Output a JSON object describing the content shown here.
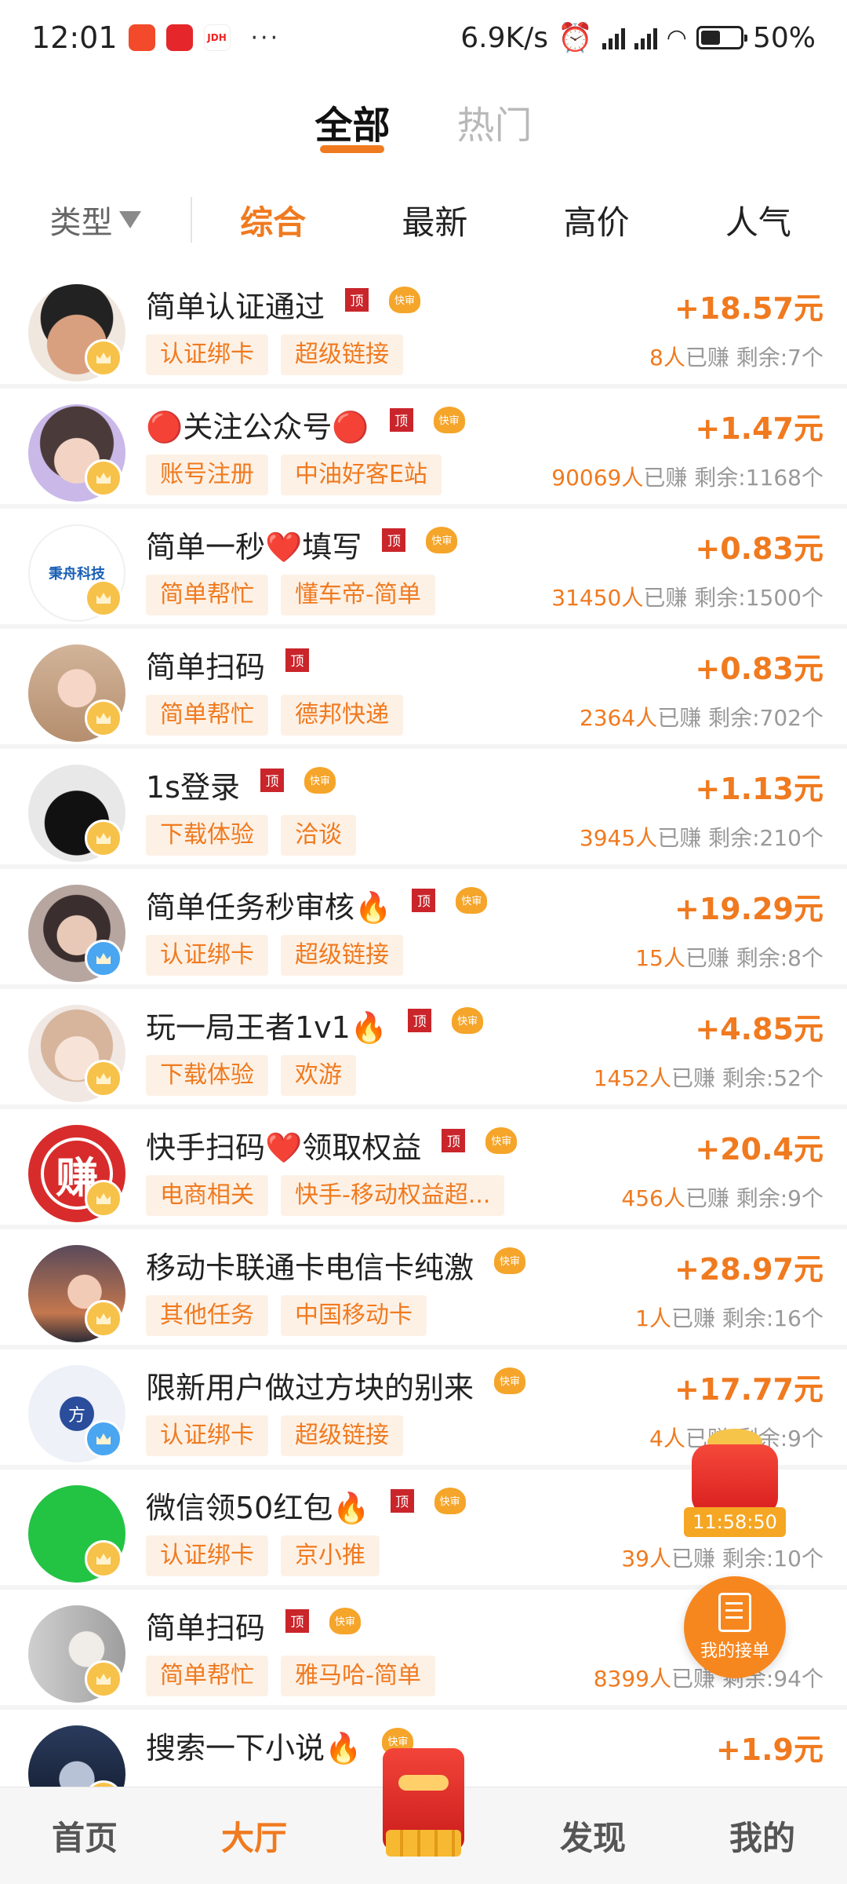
{
  "status_bar": {
    "time": "12:01",
    "app_icons": [
      "taobao-icon",
      "pdd-icon",
      "jdh-icon"
    ],
    "jdh_label": "JDH",
    "more": "···",
    "net_speed": "6.9K/s",
    "battery": "50%",
    "battery_level": 0.5
  },
  "top_tabs": [
    {
      "label": "全部",
      "active": true
    },
    {
      "label": "热门",
      "active": false
    }
  ],
  "filters": {
    "type_label": "类型",
    "sorts": [
      {
        "label": "综合",
        "active": true
      },
      {
        "label": "最新",
        "active": false
      },
      {
        "label": "高价",
        "active": false
      },
      {
        "label": "人气",
        "active": false
      }
    ]
  },
  "badges": {
    "ding": "顶",
    "kuai": "快审"
  },
  "tasks": [
    {
      "title": "简单认证通过",
      "ding": true,
      "kuai": true,
      "tags": [
        "认证绑卡",
        "超级链接"
      ],
      "price": "+18.57元",
      "earned": "8人",
      "earned_suffix": "已赚",
      "remaining": "剩余:7个",
      "avatar": "av-face1",
      "avatar_text": ""
    },
    {
      "title": "🔴关注公众号🔴",
      "ding": true,
      "kuai": true,
      "tags": [
        "账号注册",
        "中油好客E站"
      ],
      "price": "+1.47元",
      "earned": "90069人",
      "earned_suffix": "已赚",
      "remaining": "剩余:1168个",
      "avatar": "av-girl",
      "avatar_text": ""
    },
    {
      "title": "简单一秒❤️填写",
      "ding": true,
      "kuai": true,
      "tags": [
        "简单帮忙",
        "懂车帝-简单"
      ],
      "price": "+0.83元",
      "earned": "31450人",
      "earned_suffix": "已赚",
      "remaining": "剩余:1500个",
      "avatar": "av-logo",
      "avatar_text": "秉舟科技"
    },
    {
      "title": "简单扫码",
      "ding": true,
      "kuai": false,
      "tags": [
        "简单帮忙",
        "德邦快递"
      ],
      "price": "+0.83元",
      "earned": "2364人",
      "earned_suffix": "已赚",
      "remaining": "剩余:702个",
      "avatar": "av-room",
      "avatar_text": ""
    },
    {
      "title": "1s登录",
      "ding": true,
      "kuai": true,
      "tags": [
        "下载体验",
        "洽谈"
      ],
      "price": "+1.13元",
      "earned": "3945人",
      "earned_suffix": "已赚",
      "remaining": "剩余:210个",
      "avatar": "av-bat",
      "avatar_text": ""
    },
    {
      "title": "简单任务秒审核🔥",
      "ding": true,
      "kuai": true,
      "tags": [
        "认证绑卡",
        "超级链接"
      ],
      "price": "+19.29元",
      "earned": "15人",
      "earned_suffix": "已赚",
      "remaining": "剩余:8个",
      "avatar": "av-glasses",
      "avatar_text": "",
      "badge_blue": true
    },
    {
      "title": "玩一局王者1v1🔥",
      "ding": true,
      "kuai": true,
      "tags": [
        "下载体验",
        "欢游"
      ],
      "price": "+4.85元",
      "earned": "1452人",
      "earned_suffix": "已赚",
      "remaining": "剩余:52个",
      "avatar": "av-doll",
      "avatar_text": ""
    },
    {
      "title": "快手扫码❤️领取权益",
      "ding": true,
      "kuai": true,
      "tags": [
        "电商相关",
        "快手-移动权益超..."
      ],
      "price": "+20.4元",
      "earned": "456人",
      "earned_suffix": "已赚",
      "remaining": "剩余:9个",
      "avatar": "av-zhuan",
      "avatar_text": "赚"
    },
    {
      "title": "移动卡联通卡电信卡纯激",
      "ding": false,
      "kuai": true,
      "tags": [
        "其他任务",
        "中国移动卡"
      ],
      "price": "+28.97元",
      "earned": "1人",
      "earned_suffix": "已赚",
      "remaining": "剩余:16个",
      "avatar": "av-sunset",
      "avatar_text": ""
    },
    {
      "title": "限新用户做过方块的别来",
      "ding": false,
      "kuai": true,
      "tags": [
        "认证绑卡",
        "超级链接"
      ],
      "price": "+17.77元",
      "earned": "4人",
      "earned_suffix": "已赚",
      "remaining": "剩余:9个",
      "avatar": "av-block",
      "avatar_text": "方",
      "badge_blue": true
    },
    {
      "title": "微信领50红包🔥",
      "ding": true,
      "kuai": true,
      "tags": [
        "认证绑卡",
        "京小推"
      ],
      "price": "",
      "earned": "39人",
      "earned_suffix": "已赚",
      "remaining": "剩余:10个",
      "avatar": "av-wechat",
      "avatar_text": ""
    },
    {
      "title": "简单扫码",
      "ding": true,
      "kuai": true,
      "tags": [
        "简单帮忙",
        "雅马哈-简单"
      ],
      "price": "",
      "earned": "8399人",
      "earned_suffix": "已赚",
      "remaining": "剩余:94个",
      "avatar": "av-bw",
      "avatar_text": ""
    },
    {
      "title": "搜索一下小说🔥",
      "ding": false,
      "kuai": true,
      "tags": [],
      "price": "+1.9元",
      "earned": "",
      "earned_suffix": "",
      "remaining": "",
      "avatar": "av-night",
      "avatar_text": ""
    }
  ],
  "float": {
    "timer": "11:58:50",
    "my_orders": "我的接单"
  },
  "bottom_nav": [
    {
      "label": "首页",
      "active": false
    },
    {
      "label": "大厅",
      "active": true
    },
    {
      "label": "",
      "center": true
    },
    {
      "label": "发现",
      "active": false
    },
    {
      "label": "我的",
      "active": false
    }
  ]
}
